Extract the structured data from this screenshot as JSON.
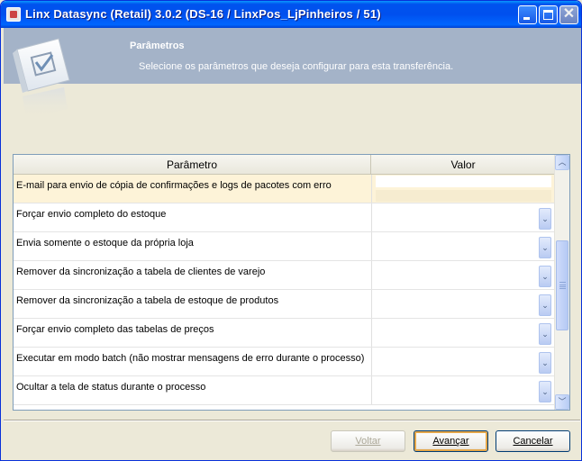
{
  "window": {
    "title": "Linx Datasync (Retail) 3.0.2 (DS-16 / LinxPos_LjPinheiros / 51)",
    "minimize_glyph": "",
    "close_glyph": "✕"
  },
  "header": {
    "title": "Parâmetros",
    "subtitle": "Selecione os parâmetros que deseja configurar para esta transferência.",
    "icon": "checklist-icon"
  },
  "grid": {
    "columns": [
      "Parâmetro",
      "Valor"
    ],
    "rows": [
      {
        "param": "E-mail para envio de cópia de confirmações e logs de pacotes com erro",
        "value": "",
        "type": "text",
        "selected": true
      },
      {
        "param": "Forçar envio completo do estoque",
        "value": "",
        "type": "dropdown"
      },
      {
        "param": "Envia somente o estoque da própria loja",
        "value": "",
        "type": "dropdown"
      },
      {
        "param": "Remover da sincronização a tabela de clientes de varejo",
        "value": "",
        "type": "dropdown"
      },
      {
        "param": "Remover da sincronização a tabela de estoque de produtos",
        "value": "",
        "type": "dropdown"
      },
      {
        "param": "Forçar envio completo das tabelas de preços",
        "value": "",
        "type": "dropdown"
      },
      {
        "param": "Executar em modo batch (não mostrar mensagens de erro durante o processo)",
        "value": "",
        "type": "dropdown"
      },
      {
        "param": "Ocultar a tela de status durante o processo",
        "value": "",
        "type": "dropdown"
      }
    ],
    "dropdown_glyph": "⌄",
    "scroll_up_glyph": "︿",
    "scroll_down_glyph": "﹀"
  },
  "buttons": {
    "back": "Voltar",
    "next": "Avançar",
    "cancel": "Cancelar"
  }
}
